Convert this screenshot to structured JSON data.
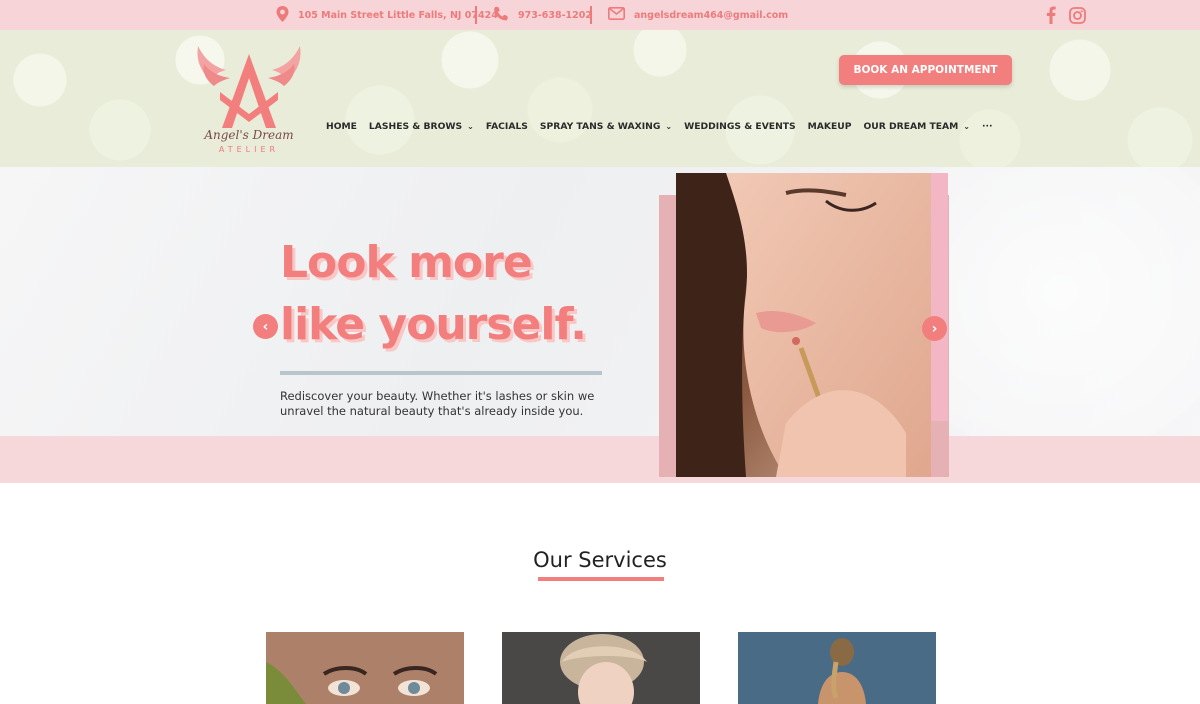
{
  "topbar": {
    "address": "105 Main Street Little Falls, NJ 07424",
    "phone": "973-638-1202",
    "email": "angelsdream464@gmail.com",
    "icons": [
      "map-pin-icon",
      "phone-icon",
      "envelope-icon",
      "facebook-icon",
      "instagram-icon"
    ],
    "color": "#ee7b7b"
  },
  "header": {
    "logo_name": "Angel's Dream",
    "logo_sub": "ATELIER",
    "book_label": "BOOK AN APPOINTMENT",
    "nav": [
      {
        "label": "HOME",
        "has_dropdown": false
      },
      {
        "label": "LASHES & BROWS",
        "has_dropdown": true
      },
      {
        "label": "FACIALS",
        "has_dropdown": false
      },
      {
        "label": "SPRAY TANS & WAXING",
        "has_dropdown": true
      },
      {
        "label": "WEDDINGS & EVENTS",
        "has_dropdown": false
      },
      {
        "label": "MAKEUP",
        "has_dropdown": false
      },
      {
        "label": "OUR DREAM TEAM",
        "has_dropdown": true
      },
      {
        "label": "···",
        "has_dropdown": false
      }
    ]
  },
  "hero": {
    "headline_line1": "Look more",
    "headline_line2": "like yourself.",
    "intro": "Rediscover your beauty. Whether it's lashes or skin we unravel the natural beauty that's already inside you.",
    "prev_arrow": "‹",
    "next_arrow": "›"
  },
  "services": {
    "title": "Our Services"
  },
  "colors": {
    "accent": "#f27f7d",
    "topbar_bg": "#f7d4d7",
    "band": "#f6d7da"
  }
}
